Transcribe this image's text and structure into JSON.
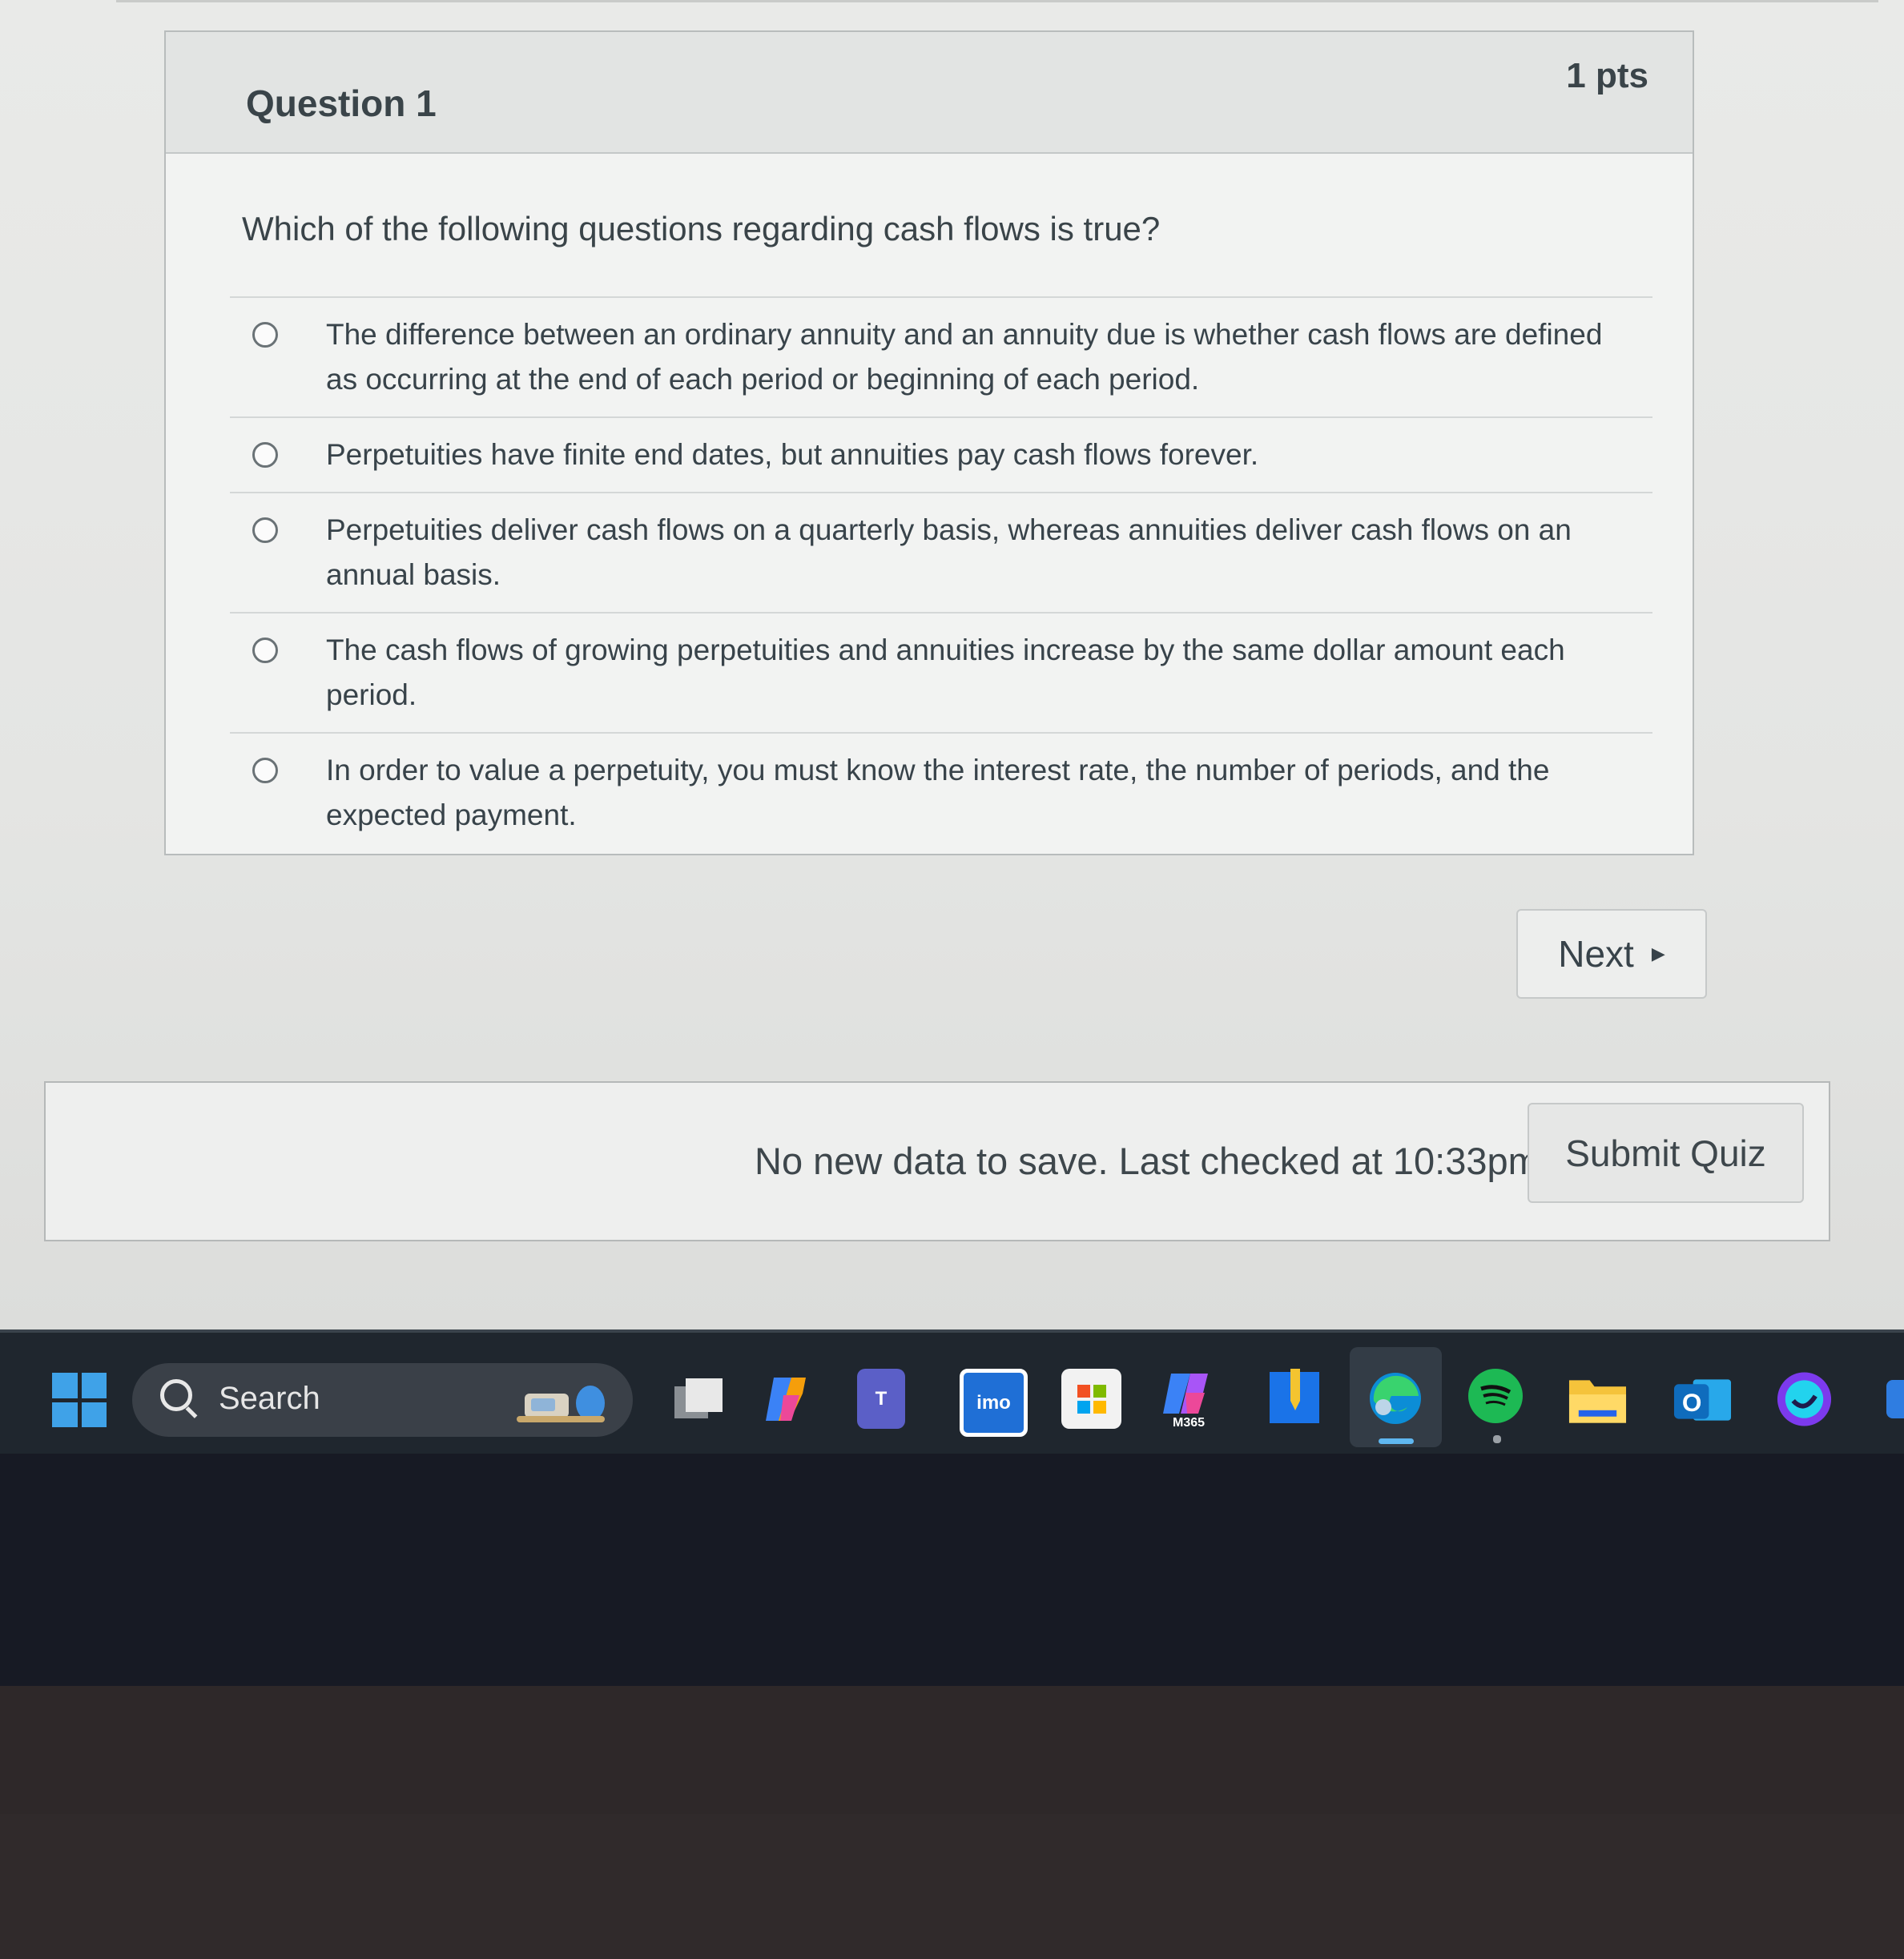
{
  "quiz": {
    "title": "Question 1",
    "points": "1 pts",
    "question": "Which of the following questions regarding cash flows is true?",
    "answers": [
      "The difference between an ordinary annuity and an annuity due is whether cash flows are defined as occurring at the end of each period or beginning of each period.",
      "Perpetuities have finite end dates, but annuities pay cash flows forever.",
      "Perpetuities deliver cash flows on a quarterly basis, whereas annuities deliver cash flows on an annual basis.",
      "The cash flows of growing perpetuities and annuities increase by the same dollar amount each period.",
      "In order to value a perpetuity, you must know the interest rate, the number of periods, and the expected payment."
    ],
    "next_label": "Next",
    "status_text": "No new data to save. Last checked at 10:33pm",
    "submit_label": "Submit Quiz"
  },
  "taskbar": {
    "search_label": "Search",
    "apps": [
      {
        "name": "task-view-icon",
        "label": ""
      },
      {
        "name": "copilot-icon",
        "label": ""
      },
      {
        "name": "teams-icon",
        "label": "T"
      },
      {
        "name": "imo-icon",
        "label": "imo"
      },
      {
        "name": "store-icon",
        "label": ""
      },
      {
        "name": "m365-icon",
        "label": "M365"
      },
      {
        "name": "notes-icon",
        "label": ""
      },
      {
        "name": "edge-icon",
        "label": ""
      },
      {
        "name": "spotify-icon",
        "label": ""
      },
      {
        "name": "file-explorer-icon",
        "label": ""
      },
      {
        "name": "outlook-icon",
        "label": "O"
      },
      {
        "name": "edge-dev-icon",
        "label": ""
      }
    ]
  },
  "colors": {
    "taskbar_bg": "#1f262e",
    "windows_blue": "#3fa2e8",
    "spotify_green": "#1db954"
  }
}
